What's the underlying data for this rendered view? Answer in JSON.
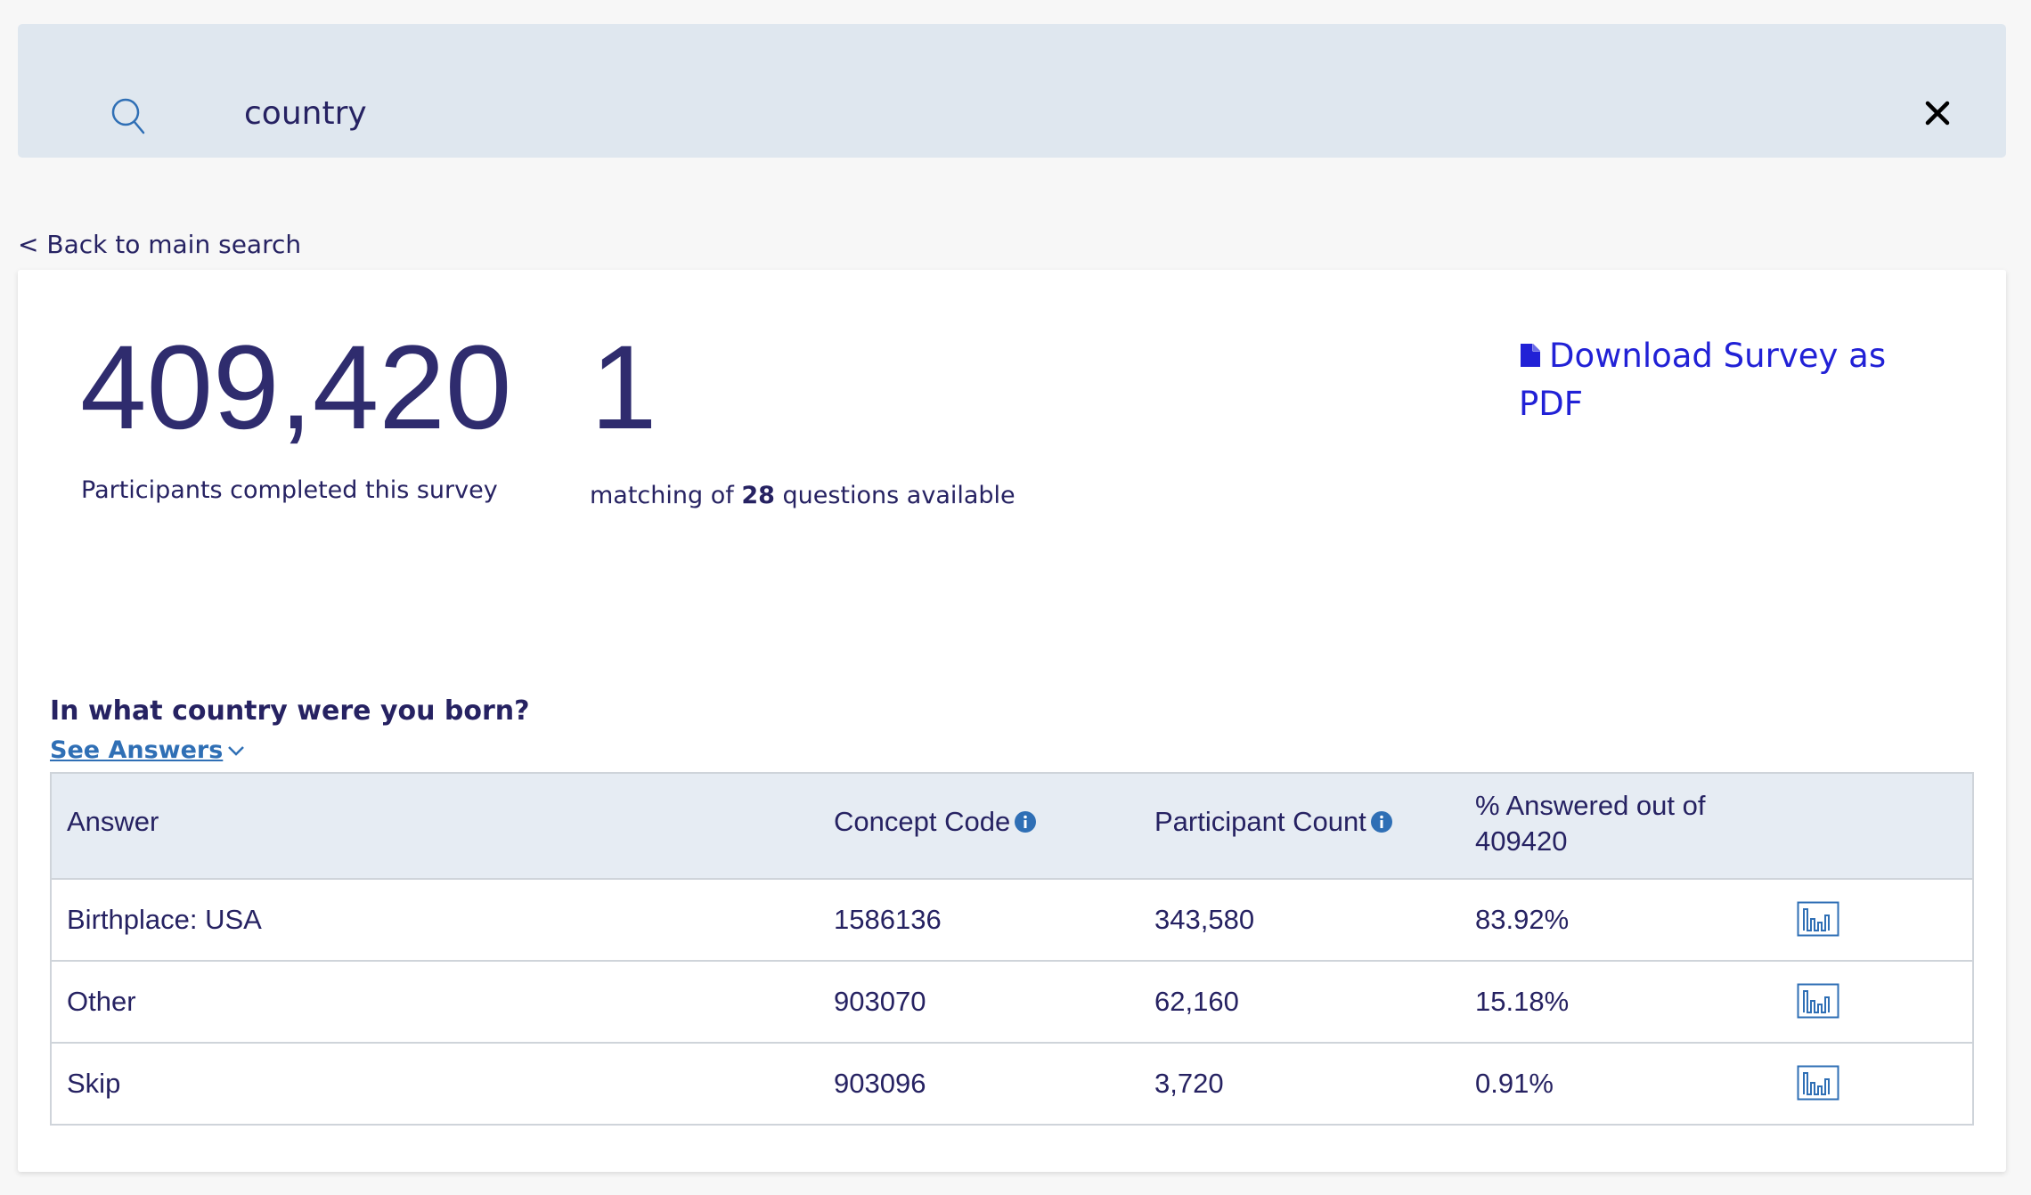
{
  "search": {
    "value": "country",
    "icon": "search-icon",
    "clear_icon": "close-icon"
  },
  "back_link": "< Back to main search",
  "stats": {
    "participants": "409,420",
    "participants_caption": "Participants completed this survey",
    "matching": "1",
    "matching_caption_prefix": "matching of ",
    "matching_total": "28",
    "matching_caption_suffix": " questions available"
  },
  "download": {
    "label": "Download Survey as PDF",
    "icon": "file-icon"
  },
  "question": {
    "title": "In what country were you born?",
    "see_answers": "See Answers"
  },
  "table": {
    "headers": {
      "answer": "Answer",
      "concept_code": "Concept Code",
      "participant_count": "Participant Count",
      "percent_answered": "% Answered out of 409420"
    },
    "rows": [
      {
        "answer": "Birthplace: USA",
        "concept_code": "1586136",
        "participant_count": "343,580",
        "percent": "83.92%"
      },
      {
        "answer": "Other",
        "concept_code": "903070",
        "participant_count": "62,160",
        "percent": "15.18%"
      },
      {
        "answer": "Skip",
        "concept_code": "903096",
        "participant_count": "3,720",
        "percent": "0.91%"
      }
    ]
  },
  "colors": {
    "accent": "#2f6fb5",
    "link": "#2121d6",
    "text": "#262262",
    "search_bg": "#dfe7ef",
    "table_header_bg": "#e6ecf3"
  }
}
